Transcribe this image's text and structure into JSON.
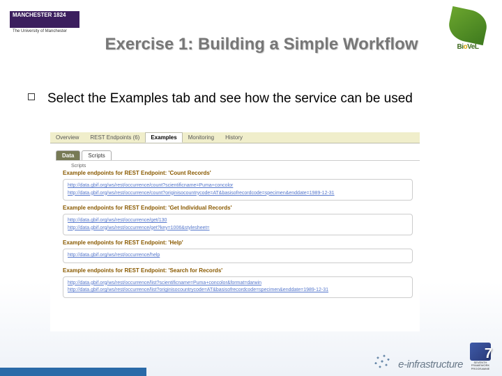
{
  "logos": {
    "manchester_top": "MANCHESTER 1824",
    "manchester_sub": "The University of Manchester",
    "biovel": "BioVeL",
    "einfra": "e-infrastructure",
    "fp7_num": "7",
    "fp7_label": "SEVENTH FRAMEWORK PROGRAMME"
  },
  "title": "Exercise 1: Building a Simple Workflow",
  "body": "Select the Examples tab and see how the service can be used",
  "screenshot": {
    "tabs_main": [
      "Overview",
      "REST Endpoints (6)",
      "Examples",
      "Monitoring",
      "History"
    ],
    "tabs_main_active": "Examples",
    "tabs_sub": [
      "Data",
      "Scripts"
    ],
    "tabs_sub_active": "Data",
    "subheader": "Scripts",
    "sections": [
      {
        "title": "Example endpoints for REST Endpoint: 'Count Records'",
        "urls": [
          "http://data.gbif.org/ws/rest/occurrence/count?scientificname=Puma+concolor",
          "http://data.gbif.org/ws/rest/occurrence/count?originisocountrycode=AT&basisofrecordcode=specimen&enddate=1989-12-31"
        ]
      },
      {
        "title": "Example endpoints for REST Endpoint: 'Get Individual Records'",
        "urls": [
          "http://data.gbif.org/ws/rest/occurrence/get/130",
          "http://data.gbif.org/ws/rest/occurrence/get?key=1006&stylesheet="
        ]
      },
      {
        "title": "Example endpoints for REST Endpoint: 'Help'",
        "urls": [
          "http://data.gbif.org/ws/rest/occurrence/help"
        ]
      },
      {
        "title": "Example endpoints for REST Endpoint: 'Search for Records'",
        "urls": [
          "http://data.gbif.org/ws/rest/occurrence/list?scientificname=Puma+concolor&format=darwin",
          "http://data.gbif.org/ws/rest/occurrence/list?originisocountrycode=AT&basisofrecordcode=specimen&enddate=1989-12-31"
        ]
      }
    ]
  }
}
